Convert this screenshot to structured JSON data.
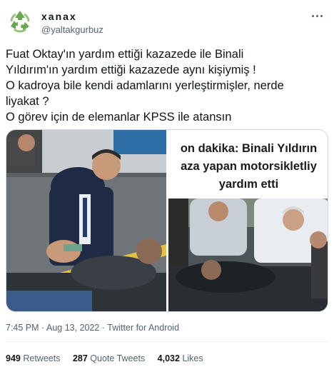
{
  "author": {
    "display_name": "xanax",
    "handle": "@yaltakgurbuz",
    "avatar_icon": "recycle-icon",
    "avatar_color": "#6aa84f"
  },
  "tweet": {
    "lines": [
      "Fuat Oktay'ın yardım ettiği kazazede ile Binali",
      "Yıldırım'ın yardım ettiği kazazede aynı kişiymiş !",
      "O kadroya bile kendi adamlarını yerleştirmişler, nerde",
      "liyakat ?",
      "O görev için de elemanlar KPSS ile atansın"
    ]
  },
  "media": {
    "right_headline": [
      "on dakika: Binali Yıldırın",
      "aza yapan motorsikletliy",
      "yardım etti"
    ]
  },
  "meta": {
    "time": "7:45 PM",
    "separator": "·",
    "date": "Aug 13, 2022",
    "source": "Twitter for Android"
  },
  "stats": {
    "retweets_count": "949",
    "retweets_label": "Retweets",
    "quotes_count": "287",
    "quotes_label": "Quote Tweets",
    "likes_count": "4,032",
    "likes_label": "Likes"
  },
  "colors": {
    "text_primary": "#0f1419",
    "text_secondary": "#536471",
    "border": "#cfd9de"
  }
}
